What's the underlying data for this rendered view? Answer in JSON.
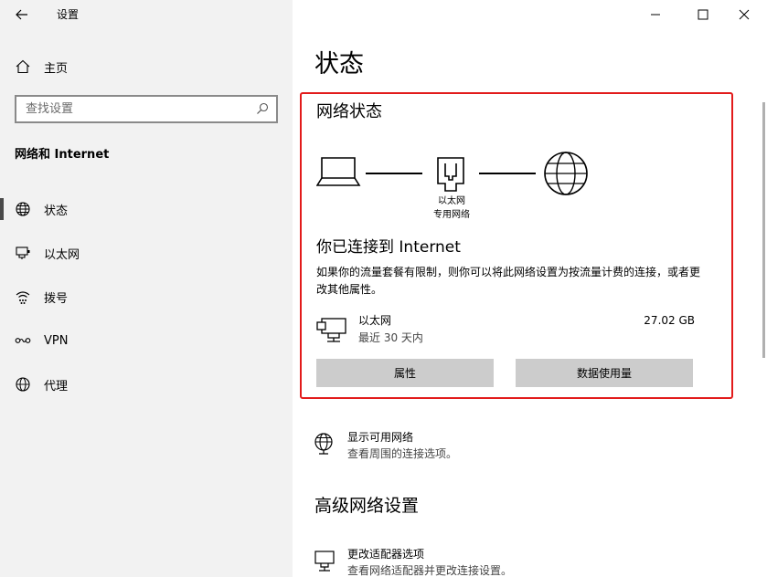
{
  "window": {
    "title": "设置",
    "back_icon": "back-arrow-icon",
    "controls": [
      "minimize-icon",
      "maximize-icon",
      "close-icon"
    ]
  },
  "sidebar": {
    "home_label": "主页",
    "search_placeholder": "查找设置",
    "section_title": "网络和 Internet",
    "items": [
      {
        "label": "状态",
        "icon": "globe-status-icon",
        "active": true
      },
      {
        "label": "以太网",
        "icon": "ethernet-icon",
        "active": false
      },
      {
        "label": "拨号",
        "icon": "dialup-icon",
        "active": false
      },
      {
        "label": "VPN",
        "icon": "vpn-icon",
        "active": false
      },
      {
        "label": "代理",
        "icon": "globe-icon",
        "active": false
      }
    ]
  },
  "main": {
    "page_title": "状态",
    "network_status": {
      "heading": "网络状态",
      "router_label_line1": "以太网",
      "router_label_line2": "专用网络",
      "connected_heading": "你已连接到 Internet",
      "description": "如果你的流量套餐有限制，则你可以将此网络设置为按流量计费的连接，或者更改其他属性。",
      "adapter": {
        "name": "以太网",
        "period": "最近 30 天内",
        "usage": "27.02 GB"
      },
      "buttons": {
        "properties": "属性",
        "data_usage": "数据使用量"
      }
    },
    "show_networks": {
      "title": "显示可用网络",
      "subtitle": "查看周围的连接选项。"
    },
    "advanced_heading": "高级网络设置",
    "change_adapter": {
      "title": "更改适配器选项",
      "subtitle": "查看网络适配器并更改连接设置。"
    }
  },
  "colors": {
    "highlight_border": "#e21b1b",
    "sidebar_bg": "#f2f2f2",
    "button_bg": "#cccccc"
  }
}
